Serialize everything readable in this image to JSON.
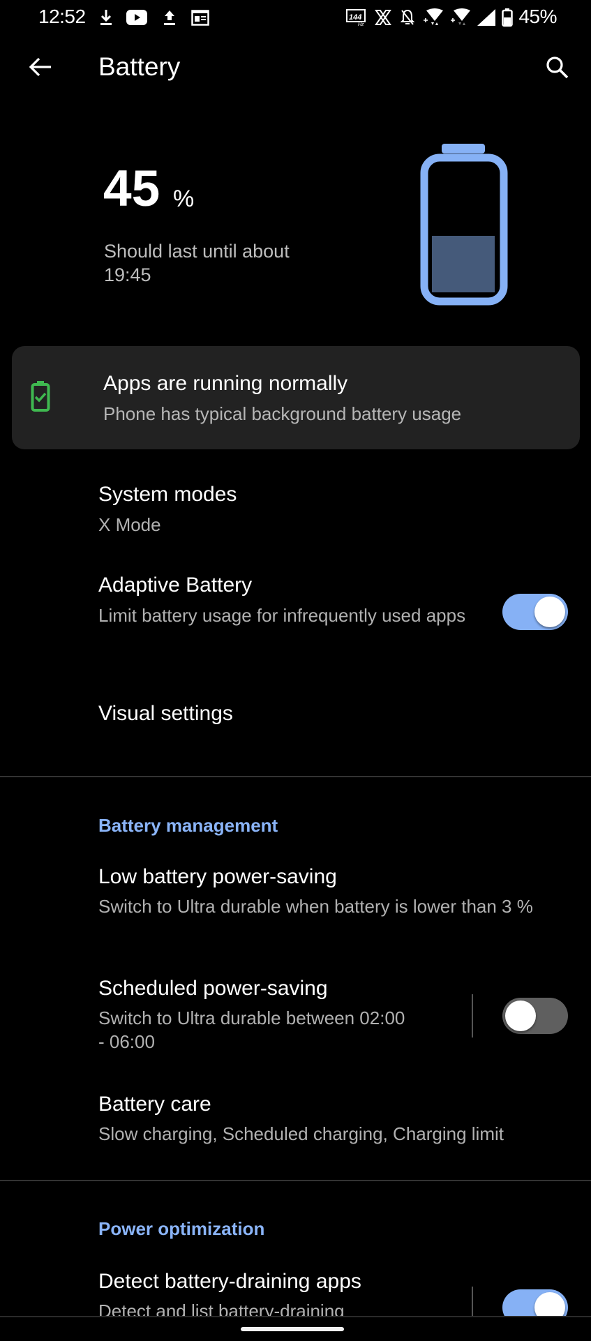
{
  "status_bar": {
    "time": "12:52",
    "left_icons": [
      "download-icon",
      "youtube-icon",
      "upload-icon",
      "calendar-widget-icon"
    ],
    "right_icons": [
      "refresh-rate-144hz-icon",
      "x-mode-icon",
      "notifications-off-icon",
      "wifi-icon",
      "wifi-secondary-icon",
      "cell-signal-icon",
      "battery-status-icon"
    ],
    "refresh_rate_label": "144",
    "refresh_rate_unit": "Hz",
    "battery_percent": "45%"
  },
  "app_bar": {
    "title": "Battery",
    "back_icon": "arrow-back-icon",
    "search_icon": "search-icon"
  },
  "battery_header": {
    "level_value": "45",
    "level_unit": "%",
    "level_fraction": 0.45,
    "estimate_line1": "Should last until about",
    "estimate_line2": "19:45",
    "accent_color": "#86b1f5",
    "fill_color": "#455a7a"
  },
  "status_card": {
    "icon": "battery-check-icon",
    "title": "Apps are running normally",
    "subtitle": "Phone has typical background battery usage",
    "icon_color": "#3fb950"
  },
  "general": [
    {
      "title": "System modes",
      "subtitle": "X Mode"
    },
    {
      "title": "Adaptive Battery",
      "subtitle": "Limit battery usage for infrequently used apps",
      "toggle": true
    },
    {
      "title": "Visual settings"
    }
  ],
  "battery_management": {
    "header": "Battery management",
    "items": [
      {
        "title": "Low battery power-saving",
        "subtitle": "Switch to Ultra durable when battery is lower than 3 %"
      },
      {
        "title": "Scheduled power-saving",
        "subtitle": "Switch to Ultra durable between 02:00 - 06:00",
        "toggle": false
      },
      {
        "title": "Battery care",
        "subtitle": "Slow charging, Scheduled charging, Charging limit"
      }
    ]
  },
  "power_optimization": {
    "header": "Power optimization",
    "items": [
      {
        "title": "Detect battery-draining apps",
        "subtitle": "Detect and list battery-draining",
        "toggle": true
      }
    ]
  },
  "colors": {
    "background": "#000000",
    "accent": "#86b1f5",
    "toggle_off": "#5f5f5f",
    "card": "#222222"
  }
}
